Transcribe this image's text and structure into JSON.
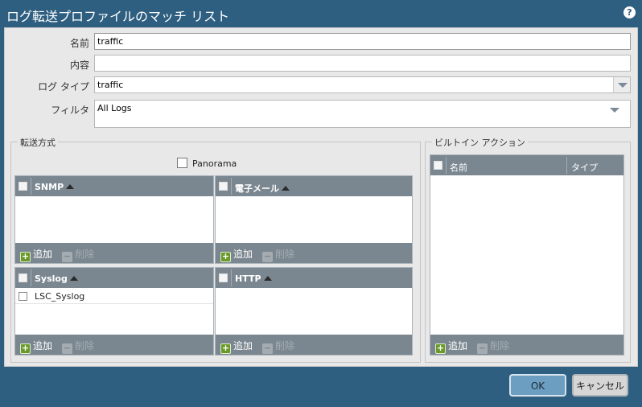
{
  "window": {
    "title": "ログ転送プロファイルのマッチ リスト"
  },
  "form": {
    "name_label": "名前",
    "name_value": "traffic",
    "description_label": "内容",
    "description_value": "",
    "logtype_label": "ログ タイプ",
    "logtype_value": "traffic",
    "filter_label": "フィルタ",
    "filter_value": "All Logs"
  },
  "forward": {
    "legend": "転送方式",
    "panorama_label": "Panorama",
    "panorama_checked": false,
    "grids": {
      "snmp": {
        "header": "SNMP",
        "rows": []
      },
      "email": {
        "header": "電子メール",
        "rows": []
      },
      "syslog": {
        "header": "Syslog",
        "rows": [
          "LSC_Syslog"
        ]
      },
      "http": {
        "header": "HTTP",
        "rows": []
      }
    },
    "add_label": "追加",
    "delete_label": "削除"
  },
  "builtin": {
    "legend": "ビルトイン アクション",
    "col_name": "名前",
    "col_type": "タイプ",
    "add_label": "追加",
    "delete_label": "削除"
  },
  "buttons": {
    "ok": "OK",
    "cancel": "キャンセル"
  },
  "colors": {
    "titlebar": "#2e5f80",
    "grid_header": "#7b8790",
    "ok_button": "#6c9ec1"
  }
}
